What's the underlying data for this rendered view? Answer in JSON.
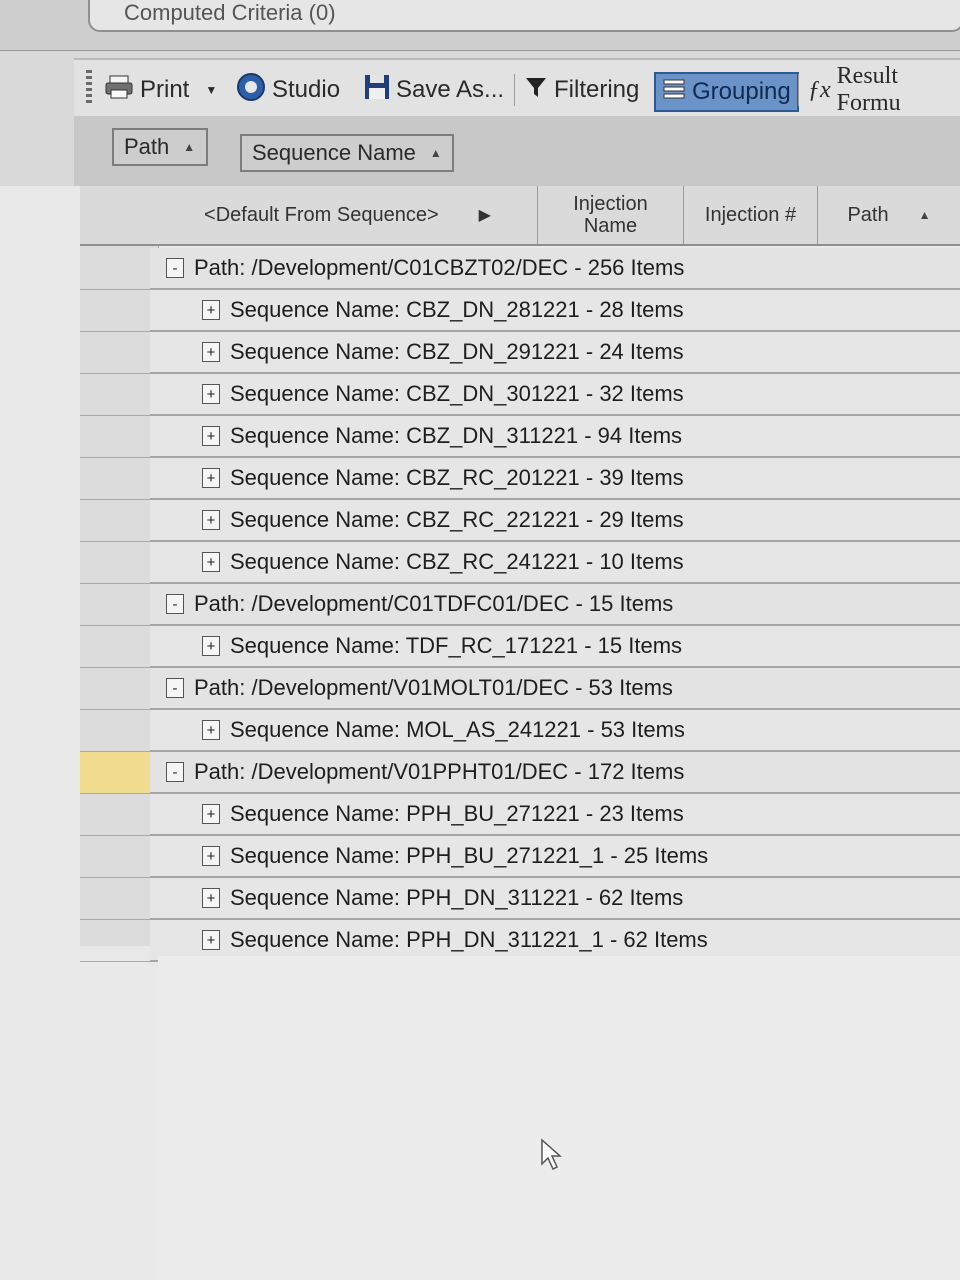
{
  "criteria": {
    "label": "Computed Criteria (0)"
  },
  "toolbar": {
    "print": "Print",
    "studio": "Studio",
    "save_as": "Save As...",
    "filtering": "Filtering",
    "grouping": "Grouping",
    "result_formula": "Result Formu"
  },
  "group_by": {
    "chip1": "Path",
    "chip2": "Sequence Name"
  },
  "columns": {
    "default": "<Default From Sequence>",
    "injection_name": "Injection Name",
    "injection_no": "Injection #",
    "path": "Path"
  },
  "rows": [
    {
      "type": "path",
      "toggle": "-",
      "text": "Path: /Development/C01CBZT02/DEC - 256 Items"
    },
    {
      "type": "seq",
      "toggle": "+",
      "text": "Sequence Name: CBZ_DN_281221 - 28 Items"
    },
    {
      "type": "seq",
      "toggle": "+",
      "text": "Sequence Name: CBZ_DN_291221 - 24 Items"
    },
    {
      "type": "seq",
      "toggle": "+",
      "text": "Sequence Name: CBZ_DN_301221 - 32 Items"
    },
    {
      "type": "seq",
      "toggle": "+",
      "text": "Sequence Name: CBZ_DN_311221 - 94 Items"
    },
    {
      "type": "seq",
      "toggle": "+",
      "text": "Sequence Name: CBZ_RC_201221 - 39 Items"
    },
    {
      "type": "seq",
      "toggle": "+",
      "text": "Sequence Name: CBZ_RC_221221 - 29 Items"
    },
    {
      "type": "seq",
      "toggle": "+",
      "text": "Sequence Name: CBZ_RC_241221 - 10 Items"
    },
    {
      "type": "path",
      "toggle": "-",
      "text": "Path: /Development/C01TDFC01/DEC - 15 Items"
    },
    {
      "type": "seq",
      "toggle": "+",
      "text": "Sequence Name: TDF_RC_171221 - 15 Items"
    },
    {
      "type": "path",
      "toggle": "-",
      "text": "Path: /Development/V01MOLT01/DEC - 53 Items"
    },
    {
      "type": "seq",
      "toggle": "+",
      "text": "Sequence Name: MOL_AS_241221 - 53 Items"
    },
    {
      "type": "path",
      "toggle": "-",
      "text": "Path: /Development/V01PPHT01/DEC - 172 Items"
    },
    {
      "type": "seq",
      "toggle": "+",
      "text": "Sequence Name: PPH_BU_271221 - 23 Items"
    },
    {
      "type": "seq",
      "toggle": "+",
      "text": "Sequence Name: PPH_BU_271221_1 - 25 Items"
    },
    {
      "type": "seq",
      "toggle": "+",
      "text": "Sequence Name: PPH_DN_311221 - 62 Items"
    },
    {
      "type": "seq",
      "toggle": "+",
      "text": "Sequence Name: PPH_DN_311221_1 - 62 Items"
    }
  ],
  "colors": {
    "grouping_active": "#6c93c7",
    "row_selected": "#f2dc90"
  }
}
